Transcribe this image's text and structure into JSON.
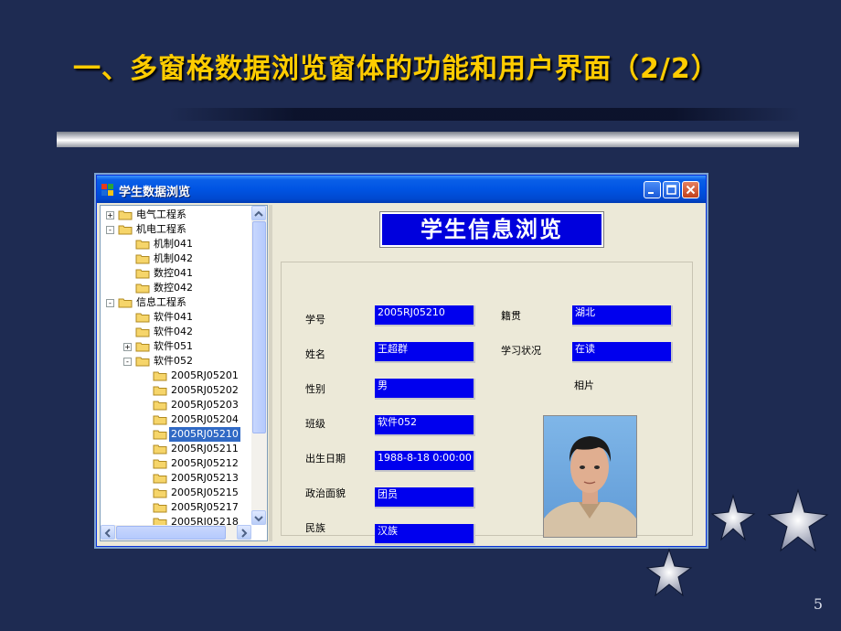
{
  "slide": {
    "title": "一、多窗格数据浏览窗体的功能和用户界面（2/2）",
    "page_number": "5"
  },
  "window": {
    "title": "学生数据浏览",
    "heading": "学生信息浏览"
  },
  "tree": {
    "nodes": [
      {
        "label": "电气工程系",
        "expander": "+"
      },
      {
        "label": "机电工程系",
        "expander": "−"
      },
      {
        "label": "机制041"
      },
      {
        "label": "机制042"
      },
      {
        "label": "数控041"
      },
      {
        "label": "数控042"
      },
      {
        "label": "信息工程系",
        "expander": "−"
      },
      {
        "label": "软件041"
      },
      {
        "label": "软件042"
      },
      {
        "label": "软件051",
        "expander": "+"
      },
      {
        "label": "软件052",
        "expander": "−"
      },
      {
        "label": "2005RJ05201"
      },
      {
        "label": "2005RJ05202"
      },
      {
        "label": "2005RJ05203"
      },
      {
        "label": "2005RJ05204"
      },
      {
        "label": "2005RJ05210",
        "selected": true
      },
      {
        "label": "2005RJ05211"
      },
      {
        "label": "2005RJ05212"
      },
      {
        "label": "2005RJ05213"
      },
      {
        "label": "2005RJ05215"
      },
      {
        "label": "2005RJ05217"
      },
      {
        "label": "2005RJ05218"
      }
    ]
  },
  "form": {
    "student_id": {
      "label": "学号",
      "value": "2005RJ05210"
    },
    "name": {
      "label": "姓名",
      "value": "王超群"
    },
    "gender": {
      "label": "性别",
      "value": "男"
    },
    "class": {
      "label": "班级",
      "value": "软件052"
    },
    "birth": {
      "label": "出生日期",
      "value": "1988-8-18 0:00:00"
    },
    "politics": {
      "label": "政治面貌",
      "value": "团员"
    },
    "ethnicity": {
      "label": "民族",
      "value": "汉族"
    },
    "hometown": {
      "label": "籍贯",
      "value": "湖北"
    },
    "status": {
      "label": "学习状况",
      "value": "在读"
    },
    "photo_label": "相片"
  },
  "colors": {
    "slide_bg": "#1e2b52",
    "title": "#ffcc00",
    "field_bg": "#0000ee",
    "selection": "#316ac5"
  }
}
